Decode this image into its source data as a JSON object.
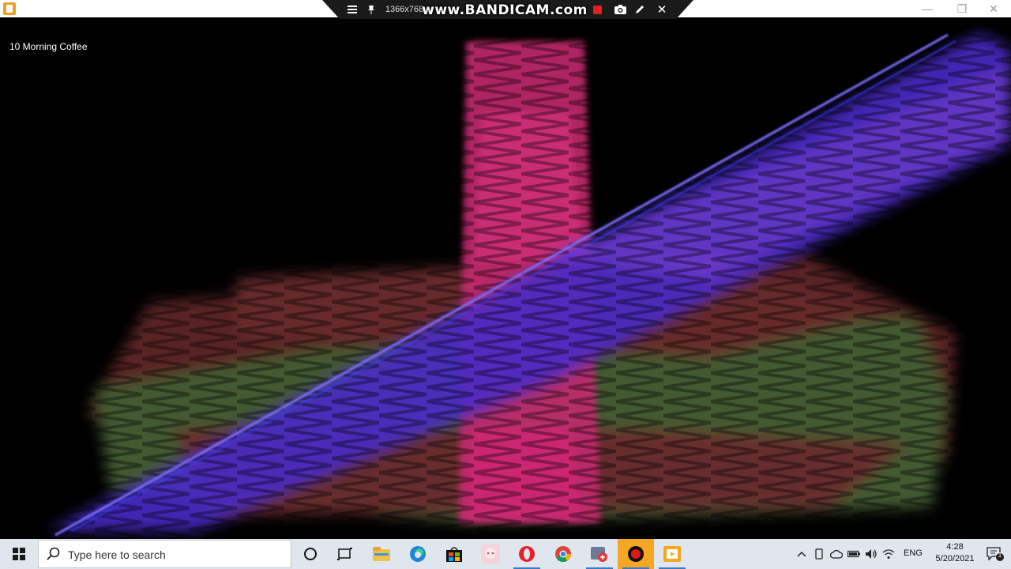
{
  "window": {
    "title_icon": "bandicam-player-icon",
    "controls": {
      "minimize": "—",
      "maximize": "❐",
      "close": "✕"
    }
  },
  "bandicam": {
    "resolution": "1366x768",
    "brand": "www.BANDICAM.com",
    "close_glyph": "✕"
  },
  "video": {
    "track_title": "10 Morning Coffee"
  },
  "taskbar": {
    "search_placeholder": "Type here to search",
    "apps": [
      {
        "name": "cortana-icon"
      },
      {
        "name": "task-view-icon"
      },
      {
        "name": "file-explorer-icon"
      },
      {
        "name": "edge-icon"
      },
      {
        "name": "store-icon"
      },
      {
        "name": "anime-app-icon"
      },
      {
        "name": "opera-icon"
      },
      {
        "name": "chrome-icon"
      },
      {
        "name": "snip-app-icon"
      },
      {
        "name": "bandicam-record-icon"
      },
      {
        "name": "media-player-icon"
      }
    ],
    "tray": {
      "language": "ENG",
      "time": "4:28",
      "date": "5/20/2021",
      "notification_count": "1"
    }
  },
  "colors": {
    "taskbar_bg": "#dfe6ee",
    "accent_blue": "#3a78c9",
    "record_highlight": "#f5a623"
  }
}
